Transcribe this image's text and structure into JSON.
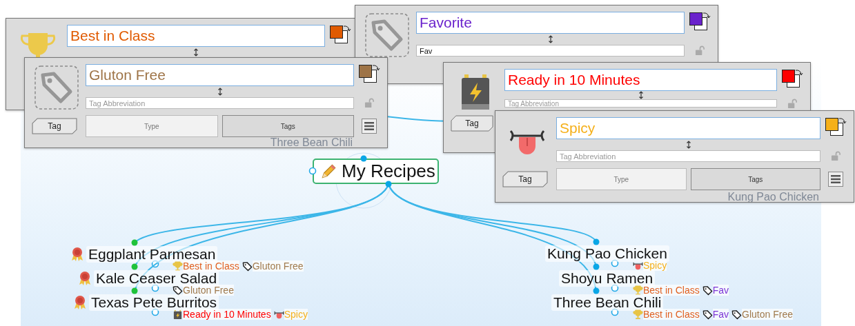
{
  "panels": [
    {
      "kind": "trophy",
      "name": "Best in Class",
      "color": "#e05a00"
    },
    {
      "kind": "tag",
      "name": "Favorite",
      "color": "#6a22cc",
      "abbreviation": {
        "value": "Fav"
      }
    },
    {
      "kind": "tag",
      "name": "Gluton Free",
      "color": "#9e7447",
      "abbreviation": {
        "placeholder": "Tag Abbreviation"
      },
      "buttons": [
        {
          "kind": "tag",
          "label": "Tag"
        },
        {
          "kind": "type",
          "label": "Type"
        },
        {
          "kind": "tags",
          "label": "Tags"
        }
      ],
      "ghost_label": "Three Bean Chili"
    },
    {
      "kind": "battery",
      "name": "Ready in 10 Minutes",
      "color": "#ff0000",
      "abbreviation": {
        "placeholder": "Tag Abbreviation"
      },
      "buttons": [
        {
          "kind": "tag",
          "label": "Tag"
        }
      ]
    },
    {
      "kind": "tongue",
      "name": "Spicy",
      "color": "#f5b01a",
      "abbreviation": {
        "placeholder": "Tag Abbreviation"
      },
      "buttons": [
        {
          "kind": "tag",
          "label": "Tag"
        },
        {
          "kind": "type",
          "label": "Type"
        },
        {
          "kind": "tags",
          "label": "Tags"
        }
      ],
      "ghost_label": "Kung Pao Chicken"
    }
  ],
  "map": {
    "root": {
      "label": "My Recipes"
    },
    "left_nodes": [
      {
        "label": "Eggplant Parmesan",
        "tags": [
          {
            "kind": "trophy",
            "label": "Best in Class",
            "color": "#e06020"
          },
          {
            "kind": "tag",
            "label": "Gluton Free",
            "color": "#a07a4c"
          }
        ]
      },
      {
        "label": "Kale Ceaser Salad",
        "tags": [
          {
            "kind": "tag",
            "label": "Gluton Free",
            "color": "#a07a4c"
          }
        ]
      },
      {
        "label": "Texas Pete Burritos",
        "tags": [
          {
            "kind": "battery",
            "label": "Ready in 10 Minutes",
            "color": "#ff0000"
          },
          {
            "kind": "tongue",
            "label": "Spicy",
            "color": "#f5b01a"
          }
        ]
      }
    ],
    "right_nodes": [
      {
        "label": "Kung Pao Chicken",
        "tags": [
          {
            "kind": "tongue",
            "label": "Spicy",
            "color": "#f5b01a"
          }
        ]
      },
      {
        "label": "Shoyu Ramen",
        "tags": [
          {
            "kind": "trophy",
            "label": "Best in Class",
            "color": "#e06020"
          },
          {
            "kind": "tag",
            "label": "Fav",
            "color": "#7b35d6"
          }
        ]
      },
      {
        "label": "Three Bean Chili",
        "tags": [
          {
            "kind": "trophy",
            "label": "Best in Class",
            "color": "#e06020"
          },
          {
            "kind": "tag",
            "label": "Fav",
            "color": "#7b35d6"
          },
          {
            "kind": "tag",
            "label": "Gluton Free",
            "color": "#a07a4c"
          }
        ]
      }
    ]
  }
}
